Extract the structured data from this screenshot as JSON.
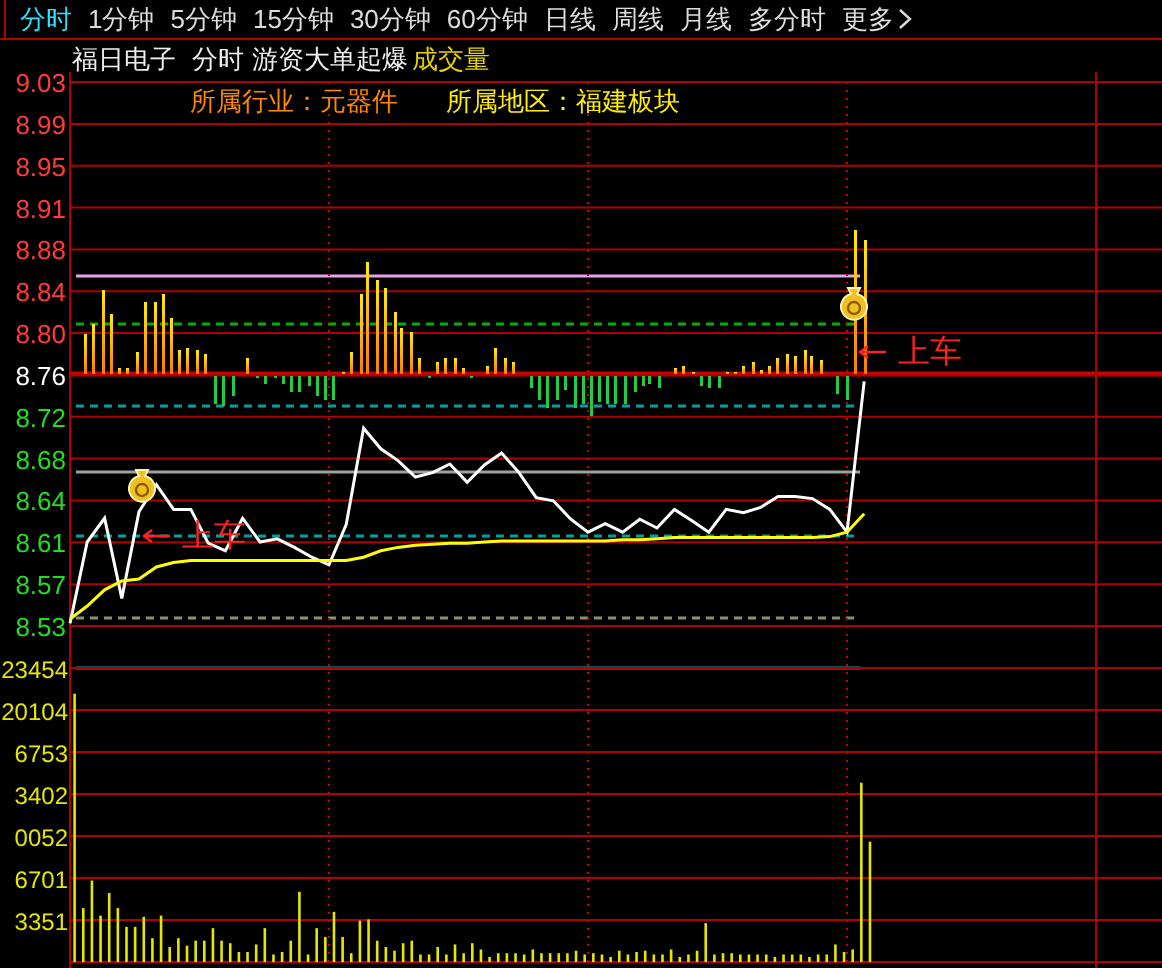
{
  "tabs": [
    {
      "label": "分时",
      "selected": true
    },
    {
      "label": "1分钟",
      "selected": false
    },
    {
      "label": "5分钟",
      "selected": false
    },
    {
      "label": "15分钟",
      "selected": false
    },
    {
      "label": "30分钟",
      "selected": false
    },
    {
      "label": "60分钟",
      "selected": false
    },
    {
      "label": "日线",
      "selected": false
    },
    {
      "label": "周线",
      "selected": false
    },
    {
      "label": "月线",
      "selected": false
    },
    {
      "label": "多分时",
      "selected": false
    }
  ],
  "more_button": {
    "label": "更多"
  },
  "stock": {
    "name": "福日电子",
    "period": "分时",
    "indicator": "游资大单起爆",
    "volume_label": "成交量"
  },
  "info": {
    "industry": "所属行业：元器件",
    "region": "所属地区：福建板块"
  },
  "price_chart": {
    "chart_data": {
      "type": "line",
      "grid": true,
      "ylim": [
        8.5286,
        9.03
      ],
      "yticks": [
        {
          "value": 9.03,
          "label": "9.03"
        },
        {
          "value": 8.9914,
          "label": "8.99"
        },
        {
          "value": 8.9529,
          "label": "8.95"
        },
        {
          "value": 8.9143,
          "label": "8.91"
        },
        {
          "value": 8.8757,
          "label": "8.88"
        },
        {
          "value": 8.8371,
          "label": "8.84"
        },
        {
          "value": 8.7986,
          "label": "8.80"
        },
        {
          "value": 8.76,
          "label": "8.76"
        },
        {
          "value": 8.7214,
          "label": "8.72"
        },
        {
          "value": 8.6829,
          "label": "8.68"
        },
        {
          "value": 8.6443,
          "label": "8.64"
        },
        {
          "value": 8.6057,
          "label": "8.61"
        },
        {
          "value": 8.5671,
          "label": "8.57"
        },
        {
          "value": 8.5286,
          "label": "8.53"
        }
      ],
      "categories": [
        null,
        null,
        null,
        null,
        null,
        null,
        null,
        null,
        null,
        null,
        null,
        null,
        null,
        null,
        null,
        null,
        null,
        null,
        null,
        null,
        null,
        null,
        null,
        null,
        null,
        null,
        null,
        null,
        null,
        null,
        null,
        null,
        null,
        null,
        null,
        null,
        null,
        null,
        null,
        null,
        null,
        null,
        null,
        null,
        null,
        null,
        null,
        null,
        null,
        null,
        null,
        null,
        null,
        null,
        null,
        null,
        null,
        null,
        null,
        null,
        null
      ],
      "series": [
        {
          "color": "#ffffff",
          "values": [
            8.531,
            8.606,
            8.628,
            8.554,
            8.634,
            8.659,
            8.636,
            8.636,
            8.605,
            8.598,
            8.628,
            8.606,
            8.609,
            8.601,
            8.592,
            8.585,
            8.622,
            8.711,
            8.692,
            8.681,
            8.666,
            8.67,
            8.678,
            8.661,
            8.677,
            8.688,
            8.67,
            8.647,
            8.644,
            8.627,
            8.615,
            8.623,
            8.615,
            8.627,
            8.619,
            8.636,
            8.626,
            8.615,
            8.636,
            8.633,
            8.638,
            8.648,
            8.648,
            8.646,
            8.636,
            8.615,
            8.754,
            null,
            null,
            null,
            null,
            null,
            null,
            null,
            null,
            null,
            null,
            null,
            null,
            null,
            null
          ]
        },
        {
          "color": "#ffff00",
          "values": [
            8.535,
            8.547,
            8.562,
            8.57,
            8.572,
            8.583,
            8.587,
            8.589,
            8.589,
            8.589,
            8.589,
            8.589,
            8.589,
            8.589,
            8.589,
            8.589,
            8.589,
            8.592,
            8.598,
            8.601,
            8.603,
            8.604,
            8.605,
            8.605,
            8.606,
            8.607,
            8.607,
            8.607,
            8.607,
            8.607,
            8.607,
            8.607,
            8.608,
            8.608,
            8.609,
            8.61,
            8.61,
            8.61,
            8.61,
            8.61,
            8.61,
            8.61,
            8.61,
            8.61,
            8.611,
            8.615,
            8.632,
            null,
            null,
            null,
            null,
            null,
            null,
            null,
            null,
            null,
            null,
            null,
            null,
            null,
            null
          ]
        }
      ]
    },
    "signals": [
      {
        "text": "上车"
      },
      {
        "text": "上车"
      }
    ]
  },
  "volume_chart": {
    "cut_tick_labels": [
      "6753",
      "3402",
      "0052"
    ],
    "chart_data": {
      "type": "bar",
      "grid": true,
      "ylim": [
        0,
        26805
      ],
      "yticks": [
        {
          "value": 23454,
          "label": "23454"
        },
        {
          "value": 20104,
          "label": "20104"
        },
        {
          "value": 6701,
          "label": "6701"
        },
        {
          "value": 3351,
          "label": "3351"
        }
      ],
      "categories": [
        null,
        null,
        null,
        null,
        null,
        null,
        null,
        null,
        null,
        null,
        null,
        null,
        null,
        null,
        null,
        null,
        null,
        null,
        null,
        null,
        null,
        null,
        null,
        null,
        null,
        null,
        null,
        null,
        null,
        null,
        null,
        null,
        null,
        null,
        null,
        null,
        null,
        null,
        null,
        null,
        null,
        null,
        null,
        null,
        null,
        null,
        null,
        null,
        null,
        null,
        null,
        null,
        null,
        null,
        null,
        null,
        null,
        null,
        null,
        null,
        null,
        null,
        null,
        null,
        null,
        null,
        null,
        null,
        null,
        null,
        null,
        null,
        null,
        null,
        null,
        null,
        null,
        null,
        null,
        null,
        null,
        null,
        null,
        null,
        null,
        null,
        null,
        null,
        null,
        null,
        null,
        null,
        null
      ],
      "series": [
        {
          "color": "#e6e600",
          "values": [
            21400,
            4300,
            6500,
            3700,
            5500,
            4300,
            2800,
            2800,
            3600,
            1900,
            3700,
            1200,
            1900,
            1300,
            1700,
            1700,
            2700,
            1700,
            1500,
            800,
            800,
            1400,
            2700,
            600,
            800,
            1700,
            5600,
            600,
            2700,
            2000,
            4000,
            2000,
            700,
            3300,
            3400,
            1700,
            1200,
            900,
            1500,
            1700,
            600,
            600,
            1200,
            600,
            1400,
            700,
            1500,
            1000,
            400,
            700,
            700,
            700,
            600,
            1000,
            700,
            700,
            700,
            700,
            900,
            600,
            700,
            600,
            400,
            900,
            600,
            800,
            900,
            600,
            600,
            1000,
            400,
            600,
            900,
            3100,
            600,
            700,
            700,
            600,
            600,
            600,
            600,
            400,
            600,
            600,
            600,
            400,
            600,
            600,
            1400,
            800,
            1000,
            14300,
            9600
          ]
        }
      ]
    }
  }
}
